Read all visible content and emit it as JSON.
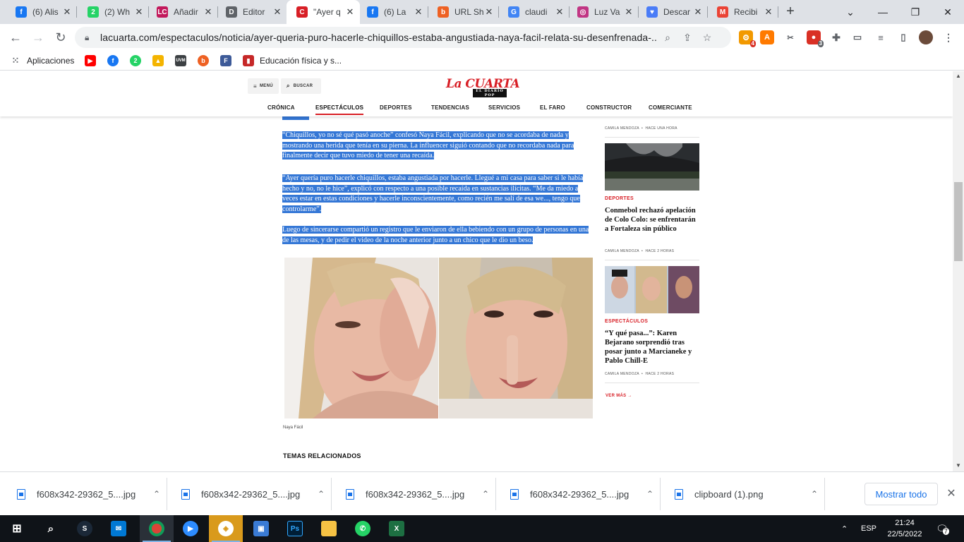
{
  "browser": {
    "tabs": [
      {
        "title": "(6) Alis",
        "icon": "facebook-icon",
        "color": "#1877f2",
        "glyph": "f"
      },
      {
        "title": "(2) Wh",
        "icon": "whatsapp-icon",
        "color": "#25d366",
        "glyph": "2"
      },
      {
        "title": "Añadir",
        "icon": "la-cuarta-icon",
        "color": "#c2185b",
        "glyph": "LC"
      },
      {
        "title": "Editor",
        "icon": "document-icon",
        "color": "#5f6368",
        "glyph": "D"
      },
      {
        "title": "\"Ayer q",
        "icon": "la-cuarta-c-icon",
        "color": "#d81f26",
        "glyph": "C"
      },
      {
        "title": "(6) La",
        "icon": "facebook-icon",
        "color": "#1877f2",
        "glyph": "f"
      },
      {
        "title": "URL Sh",
        "icon": "bitly-icon",
        "color": "#ee6123",
        "glyph": "b"
      },
      {
        "title": "claudi",
        "icon": "google-icon",
        "color": "#4285f4",
        "glyph": "G"
      },
      {
        "title": "Luz Va",
        "icon": "instagram-icon",
        "color": "#c13584",
        "glyph": "◎"
      },
      {
        "title": "Descar",
        "icon": "heart-icon",
        "color": "#4a7cf7",
        "glyph": "♥"
      },
      {
        "title": "Recibi",
        "icon": "gmail-icon",
        "color": "#ea4335",
        "glyph": "M"
      }
    ],
    "url": "lacuarta.com/espectaculos/noticia/ayer-queria-puro-hacerle-chiquillos-estaba-angustiada-naya-facil-relata-su-desenfrenada-...",
    "bookmarks": {
      "apps_label": "Aplicaciones",
      "folder_label": "Educación física y s..."
    }
  },
  "site": {
    "menu_label": "MENÚ",
    "search_label": "BUSCAR",
    "logo": "La CUARTA",
    "logo_sub": "EL DIARIO POP",
    "nav": [
      "CRÓNICA",
      "ESPECTÁCULOS",
      "DEPORTES",
      "TENDENCIAS",
      "SERVICIOS",
      "EL FARO",
      "CONSTRUCTOR",
      "COMERCIANTE"
    ]
  },
  "article": {
    "p1": "“Chiquillos, yo no sé qué pasó anoche” confesó Naya Fácil, explicando que no se acordaba de nada y mostrando una herida que tenía en su pierna. La influencer siguió contando que no recordaba nada para finalmente decir que tuvo miedo de tener una recaída.",
    "p2": "“Ayer quería puro hacerle chiquillos, estaba angustiada por hacerle. Llegué a mi casa para saber si le había hecho y no, no le hice”, explicó con respecto a una posible recaída en sustancias ilícitas. “Me da miedo a veces estar en estas condiciones y hacerle inconscientemente, como recién me salí de esa we..., tengo que controlarme”.",
    "p3": "Luego de sincerarse compartió un registro que le enviaron de ella bebiendo con un grupo de personas en una de las mesas, y de pedir el video de la noche anterior junto a un chico que le dio un beso.",
    "caption": "Naya Fácil",
    "related_heading": "TEMAS RELACIONADOS"
  },
  "sidebar": {
    "top_meta": {
      "author": "CAMILA MENDOZA",
      "time": "HACE UNA HORA"
    },
    "items": [
      {
        "category": "DEPORTES",
        "title": "Conmebol rechazó apelación de Colo Colo: se enfrentarán a Fortaleza sin público",
        "author": "CAMILA MENDOZA",
        "time": "HACE 2 HORAS"
      },
      {
        "category": "ESPECTÁCULOS",
        "title": "“Y qué pasa...”: Karen Bejarano sorprendió tras posar junto a Marcianeke y Pablo Chill-E",
        "author": "CAMILA MENDOZA",
        "time": "HACE 2 HORAS"
      }
    ],
    "see_more": "VER MÁS"
  },
  "downloads": {
    "items": [
      "f608x342-29362_5....jpg",
      "f608x342-29362_5....jpg",
      "f608x342-29362_5....jpg",
      "f608x342-29362_5....jpg",
      "clipboard (1).png"
    ],
    "show_all": "Mostrar todo"
  },
  "taskbar": {
    "language": "ESP",
    "time": "21:24",
    "date": "22/5/2022",
    "notifications": "7"
  },
  "colors": {
    "brand_red": "#d81f26",
    "selection_blue": "#3477d6",
    "chrome_tabstrip": "#dee1e6",
    "link_blue": "#1a73e8"
  }
}
